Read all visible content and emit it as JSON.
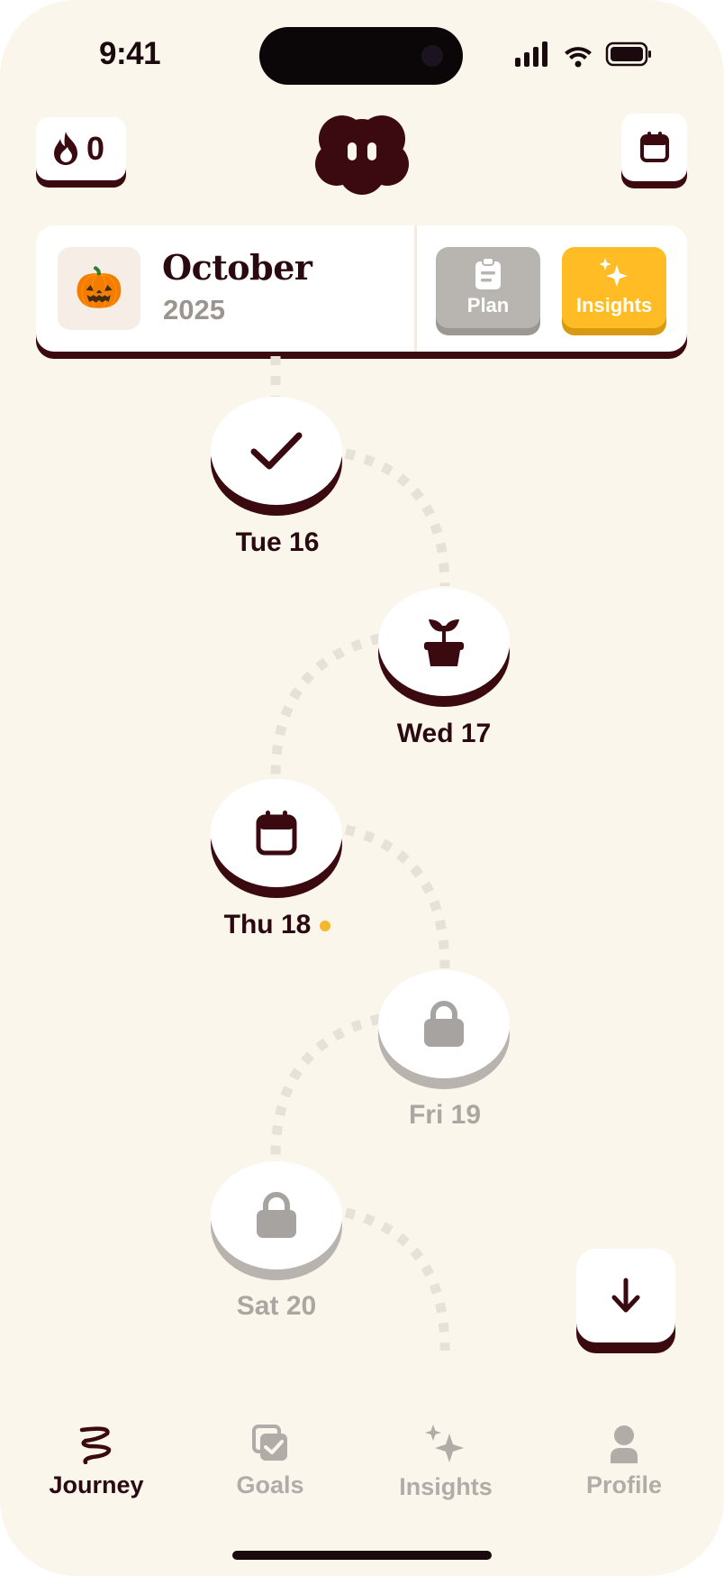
{
  "status_bar": {
    "time": "9:41"
  },
  "header": {
    "streak_count": "0",
    "streak_icon": "flame-icon",
    "calendar_icon": "calendar-icon",
    "mascot_icon": "mascot-icon"
  },
  "month_card": {
    "emoji": "🎃",
    "month": "October",
    "year": "2025",
    "plan_label": "Plan",
    "insights_label": "Insights"
  },
  "days": [
    {
      "label": "Tue 16",
      "state": "completed",
      "icon": "check-icon"
    },
    {
      "label": "Wed 17",
      "state": "available",
      "icon": "plant-icon"
    },
    {
      "label": "Thu 18",
      "state": "today",
      "icon": "calendar-icon",
      "indicator": "dot"
    },
    {
      "label": "Fri 19",
      "state": "locked",
      "icon": "lock-icon"
    },
    {
      "label": "Sat 20",
      "state": "locked",
      "icon": "lock-icon"
    }
  ],
  "scroll_button": {
    "icon": "arrow-down-icon"
  },
  "tabs": [
    {
      "label": "Journey",
      "icon": "journey-icon",
      "active": true
    },
    {
      "label": "Goals",
      "icon": "goals-icon",
      "active": false
    },
    {
      "label": "Insights",
      "icon": "sparkles-icon",
      "active": false
    },
    {
      "label": "Profile",
      "icon": "profile-icon",
      "active": false
    }
  ],
  "colors": {
    "background": "#FBF6EB",
    "primary_dark": "#3A0A10",
    "accent_yellow": "#FFBC24",
    "muted_gray": "#B8B5B1"
  }
}
